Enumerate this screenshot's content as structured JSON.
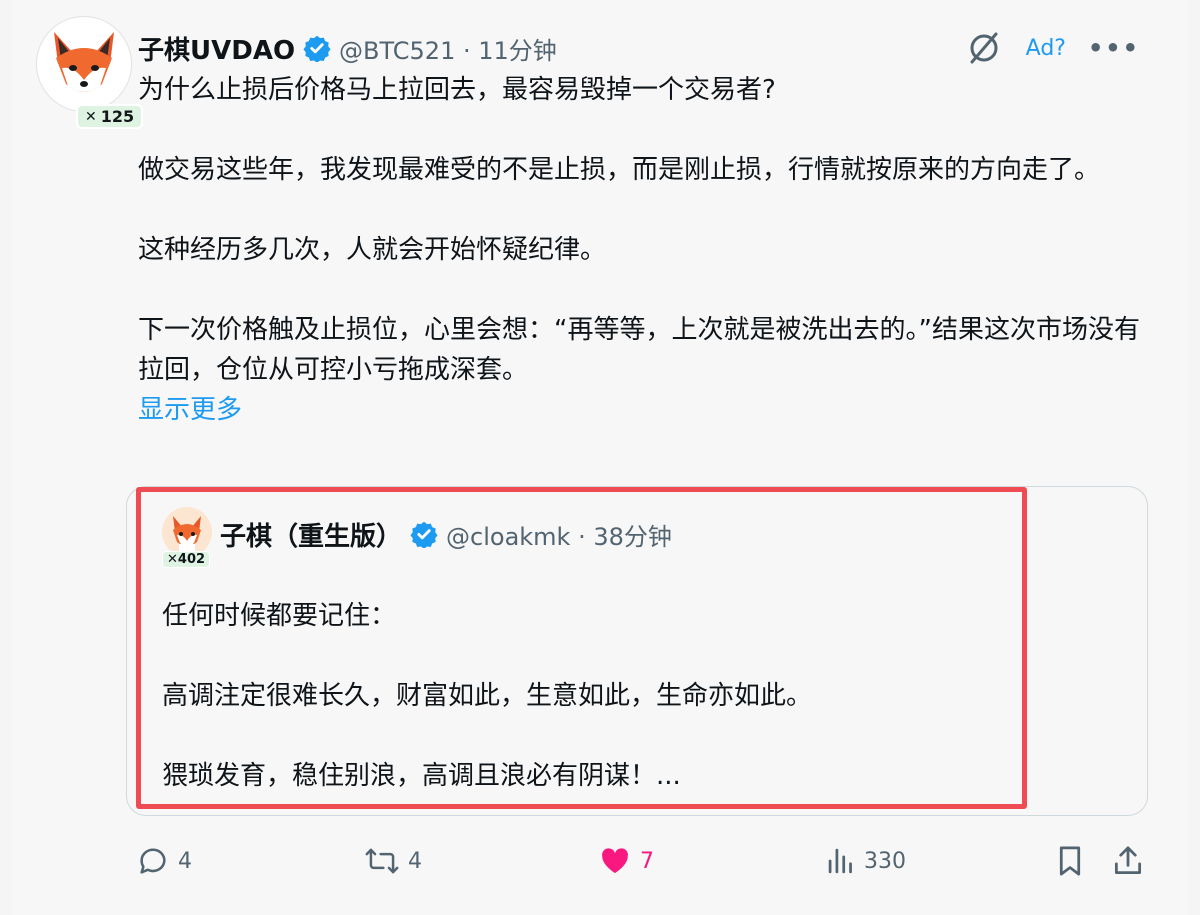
{
  "author": {
    "display_name": "子棋UVDAO",
    "handle": "@BTC521",
    "timestamp": "11分钟",
    "badge_count": "125"
  },
  "header_icons": {
    "grok_icon": "slashed-circle-icon",
    "ad_label": "Ad?",
    "more_label": "•••"
  },
  "tweet": {
    "paragraphs": [
      "为什么止损后价格马上拉回去，最容易毁掉一个交易者?",
      "做交易这些年，我发现最难受的不是止损，而是刚止损，行情就按原来的方向走了。",
      "这种经历多几次，人就会开始怀疑纪律。",
      "下一次价格触及止损位，心里会想：“再等等，上次就是被洗出去的。”结果这次市场没有拉回，仓位从可控小亏拖成深套。"
    ],
    "show_more": "显示更多"
  },
  "quote": {
    "display_name": "子棋（重生版）",
    "handle": "@cloakmk",
    "timestamp": "38分钟",
    "badge_count": "402",
    "paragraphs": [
      "任何时候都要记住：",
      "高调注定很难长久，财富如此，生意如此，生命亦如此。",
      "猥琐发育，稳住别浪，高调且浪必有阴谋！..."
    ]
  },
  "actions": {
    "replies": "4",
    "retweets": "4",
    "likes": "7",
    "views": "330"
  },
  "colors": {
    "accent": "#1d9bf0",
    "like": "#f91880",
    "highlight_box": "#ee4b52",
    "secondary_text": "#536471"
  }
}
